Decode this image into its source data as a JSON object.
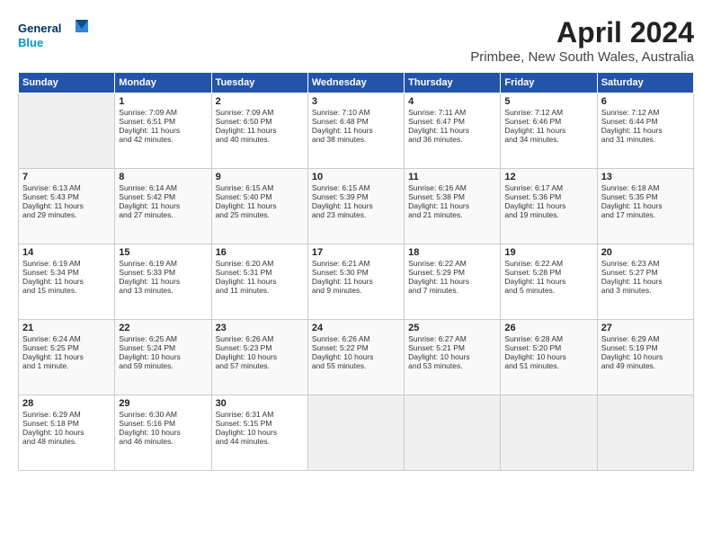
{
  "logo": {
    "line1": "General",
    "line2": "Blue"
  },
  "title": "April 2024",
  "subtitle": "Primbee, New South Wales, Australia",
  "headers": [
    "Sunday",
    "Monday",
    "Tuesday",
    "Wednesday",
    "Thursday",
    "Friday",
    "Saturday"
  ],
  "weeks": [
    [
      {
        "day": "",
        "info": ""
      },
      {
        "day": "1",
        "info": "Sunrise: 7:09 AM\nSunset: 6:51 PM\nDaylight: 11 hours\nand 42 minutes."
      },
      {
        "day": "2",
        "info": "Sunrise: 7:09 AM\nSunset: 6:50 PM\nDaylight: 11 hours\nand 40 minutes."
      },
      {
        "day": "3",
        "info": "Sunrise: 7:10 AM\nSunset: 6:48 PM\nDaylight: 11 hours\nand 38 minutes."
      },
      {
        "day": "4",
        "info": "Sunrise: 7:11 AM\nSunset: 6:47 PM\nDaylight: 11 hours\nand 36 minutes."
      },
      {
        "day": "5",
        "info": "Sunrise: 7:12 AM\nSunset: 6:46 PM\nDaylight: 11 hours\nand 34 minutes."
      },
      {
        "day": "6",
        "info": "Sunrise: 7:12 AM\nSunset: 6:44 PM\nDaylight: 11 hours\nand 31 minutes."
      }
    ],
    [
      {
        "day": "7",
        "info": "Sunrise: 6:13 AM\nSunset: 5:43 PM\nDaylight: 11 hours\nand 29 minutes."
      },
      {
        "day": "8",
        "info": "Sunrise: 6:14 AM\nSunset: 5:42 PM\nDaylight: 11 hours\nand 27 minutes."
      },
      {
        "day": "9",
        "info": "Sunrise: 6:15 AM\nSunset: 5:40 PM\nDaylight: 11 hours\nand 25 minutes."
      },
      {
        "day": "10",
        "info": "Sunrise: 6:15 AM\nSunset: 5:39 PM\nDaylight: 11 hours\nand 23 minutes."
      },
      {
        "day": "11",
        "info": "Sunrise: 6:16 AM\nSunset: 5:38 PM\nDaylight: 11 hours\nand 21 minutes."
      },
      {
        "day": "12",
        "info": "Sunrise: 6:17 AM\nSunset: 5:36 PM\nDaylight: 11 hours\nand 19 minutes."
      },
      {
        "day": "13",
        "info": "Sunrise: 6:18 AM\nSunset: 5:35 PM\nDaylight: 11 hours\nand 17 minutes."
      }
    ],
    [
      {
        "day": "14",
        "info": "Sunrise: 6:19 AM\nSunset: 5:34 PM\nDaylight: 11 hours\nand 15 minutes."
      },
      {
        "day": "15",
        "info": "Sunrise: 6:19 AM\nSunset: 5:33 PM\nDaylight: 11 hours\nand 13 minutes."
      },
      {
        "day": "16",
        "info": "Sunrise: 6:20 AM\nSunset: 5:31 PM\nDaylight: 11 hours\nand 11 minutes."
      },
      {
        "day": "17",
        "info": "Sunrise: 6:21 AM\nSunset: 5:30 PM\nDaylight: 11 hours\nand 9 minutes."
      },
      {
        "day": "18",
        "info": "Sunrise: 6:22 AM\nSunset: 5:29 PM\nDaylight: 11 hours\nand 7 minutes."
      },
      {
        "day": "19",
        "info": "Sunrise: 6:22 AM\nSunset: 5:28 PM\nDaylight: 11 hours\nand 5 minutes."
      },
      {
        "day": "20",
        "info": "Sunrise: 6:23 AM\nSunset: 5:27 PM\nDaylight: 11 hours\nand 3 minutes."
      }
    ],
    [
      {
        "day": "21",
        "info": "Sunrise: 6:24 AM\nSunset: 5:25 PM\nDaylight: 11 hours\nand 1 minute."
      },
      {
        "day": "22",
        "info": "Sunrise: 6:25 AM\nSunset: 5:24 PM\nDaylight: 10 hours\nand 59 minutes."
      },
      {
        "day": "23",
        "info": "Sunrise: 6:26 AM\nSunset: 5:23 PM\nDaylight: 10 hours\nand 57 minutes."
      },
      {
        "day": "24",
        "info": "Sunrise: 6:26 AM\nSunset: 5:22 PM\nDaylight: 10 hours\nand 55 minutes."
      },
      {
        "day": "25",
        "info": "Sunrise: 6:27 AM\nSunset: 5:21 PM\nDaylight: 10 hours\nand 53 minutes."
      },
      {
        "day": "26",
        "info": "Sunrise: 6:28 AM\nSunset: 5:20 PM\nDaylight: 10 hours\nand 51 minutes."
      },
      {
        "day": "27",
        "info": "Sunrise: 6:29 AM\nSunset: 5:19 PM\nDaylight: 10 hours\nand 49 minutes."
      }
    ],
    [
      {
        "day": "28",
        "info": "Sunrise: 6:29 AM\nSunset: 5:18 PM\nDaylight: 10 hours\nand 48 minutes."
      },
      {
        "day": "29",
        "info": "Sunrise: 6:30 AM\nSunset: 5:16 PM\nDaylight: 10 hours\nand 46 minutes."
      },
      {
        "day": "30",
        "info": "Sunrise: 6:31 AM\nSunset: 5:15 PM\nDaylight: 10 hours\nand 44 minutes."
      },
      {
        "day": "",
        "info": ""
      },
      {
        "day": "",
        "info": ""
      },
      {
        "day": "",
        "info": ""
      },
      {
        "day": "",
        "info": ""
      }
    ]
  ]
}
